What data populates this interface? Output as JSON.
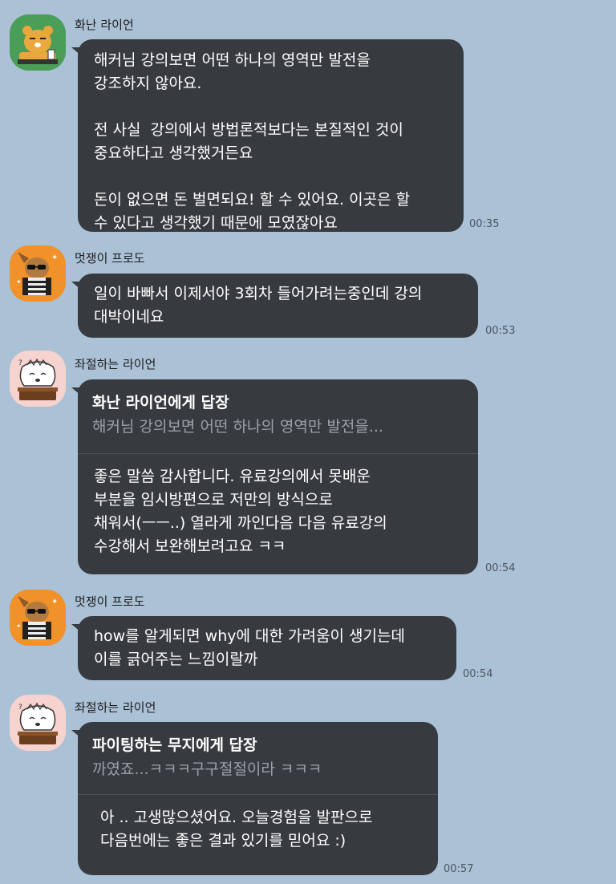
{
  "messages": [
    {
      "sender": "화난 라이언",
      "avatar": "ryan-angry-icon",
      "text": "해커님 강의보면 어떤 하나의 영역만 발전을\n강조하지 않아요.\n\n전 사실  강의에서 방법론적보다는 본질적인 것이\n중요하다고 생각했거든요\n\n돈이 없으면 돈 벌면되요! 할 수 있어요. 이곳은 할\n수 있다고 생각했기 때문에 모였잖아요",
      "time": "00:35"
    },
    {
      "sender": "멋쟁이 프로도",
      "avatar": "frodo-sunglasses-icon",
      "text": "일이 바빠서 이제서야 3회차 들어가려는중인데 강의\n대박이네요",
      "time": "00:53"
    },
    {
      "sender": "좌절하는 라이언",
      "avatar": "ryan-frustrated-icon",
      "reply_title": "화난 라이언에게 답장",
      "reply_quote": "해커님 강의보면 어떤 하나의 영역만 발전을...",
      "text": "좋은 말씀 감사합니다. 유료강의에서 못배운\n부분을 임시방편으로 저만의 방식으로\n채워서(ㅡㅡ..) 열라게 까인다음 다음 유료강의\n수강해서 보완해보려고요 ㅋㅋ",
      "time": "00:54"
    },
    {
      "sender": "멋쟁이 프로도",
      "avatar": "frodo-sunglasses-icon",
      "text": "how를 알게되면 why에 대한 가려움이 생기는데\n이를 긁어주는 느낌이랄까",
      "time": "00:54"
    },
    {
      "sender": "좌절하는 라이언",
      "avatar": "ryan-frustrated-icon",
      "reply_title": "파이팅하는 무지에게 답장",
      "reply_quote": "까였죠...ㅋㅋㅋ구구절절이라 ㅋㅋㅋ",
      "text": "아 .. 고생많으셨어요. 오늘경험을 발판으로\n다음번에는 좋은 결과 있기를 믿어요 :)",
      "time": "00:57"
    }
  ],
  "colors": {
    "background": "#abc1d6",
    "bubble": "#373b40",
    "ryan_angry_bg": "#4a9e58",
    "frodo_bg": "#f0912a",
    "ryan_frustrated_bg": "#f7d3cf"
  }
}
